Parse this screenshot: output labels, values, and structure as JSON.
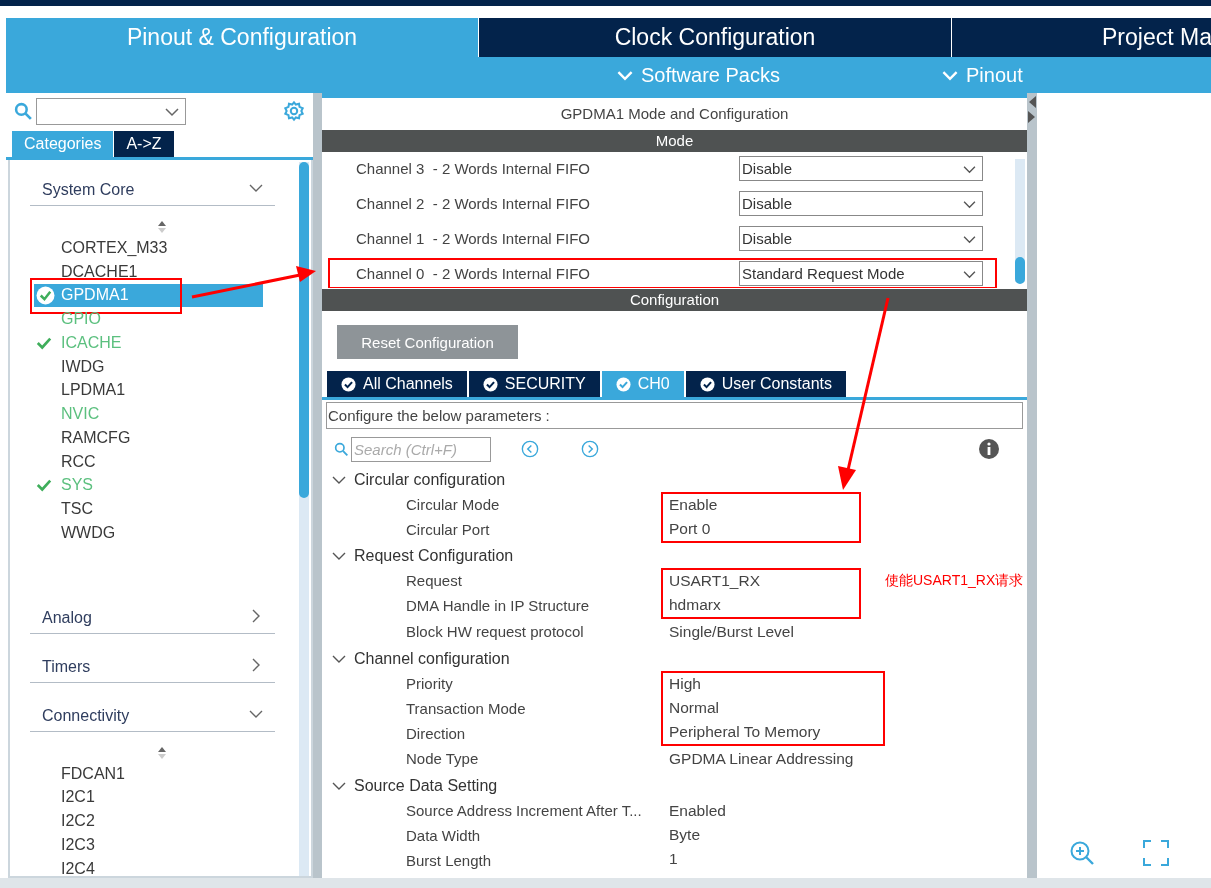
{
  "top_tabs": [
    {
      "label": "Pinout & Configuration",
      "selected": true
    },
    {
      "label": "Clock Configuration",
      "selected": false
    },
    {
      "label": "Project Ma",
      "selected": false
    }
  ],
  "sub_menu": [
    "Software Packs",
    "Pinout"
  ],
  "sidebar": {
    "tabs": [
      {
        "label": "Categories",
        "selected": true
      },
      {
        "label": "A->Z",
        "selected": false
      }
    ],
    "groups": [
      {
        "label": "System Core",
        "expanded": true,
        "items": [
          {
            "label": "CORTEX_M33",
            "checked": false,
            "configured": false,
            "selected": false,
            "highlighted": false
          },
          {
            "label": "DCACHE1",
            "checked": false,
            "configured": false,
            "selected": false,
            "highlighted": false
          },
          {
            "label": "GPDMA1",
            "checked": true,
            "configured": true,
            "selected": true,
            "highlighted": true
          },
          {
            "label": "GPIO",
            "checked": false,
            "configured": true,
            "selected": false,
            "highlighted": false
          },
          {
            "label": "ICACHE",
            "checked": true,
            "configured": true,
            "selected": false,
            "highlighted": false
          },
          {
            "label": "IWDG",
            "checked": false,
            "configured": false,
            "selected": false,
            "highlighted": false
          },
          {
            "label": "LPDMA1",
            "checked": false,
            "configured": false,
            "selected": false,
            "highlighted": false
          },
          {
            "label": "NVIC",
            "checked": false,
            "configured": true,
            "selected": false,
            "highlighted": false
          },
          {
            "label": "RAMCFG",
            "checked": false,
            "configured": false,
            "selected": false,
            "highlighted": false
          },
          {
            "label": "RCC",
            "checked": false,
            "configured": false,
            "selected": false,
            "highlighted": false
          },
          {
            "label": "SYS",
            "checked": true,
            "configured": true,
            "selected": false,
            "highlighted": false
          },
          {
            "label": "TSC",
            "checked": false,
            "configured": false,
            "selected": false,
            "highlighted": false
          },
          {
            "label": "WWDG",
            "checked": false,
            "configured": false,
            "selected": false,
            "highlighted": false
          }
        ]
      },
      {
        "label": "Analog",
        "expanded": false
      },
      {
        "label": "Timers",
        "expanded": false
      },
      {
        "label": "Connectivity",
        "expanded": true,
        "items": [
          {
            "label": "FDCAN1",
            "checked": false,
            "configured": false,
            "selected": false,
            "highlighted": false
          },
          {
            "label": "I2C1",
            "checked": false,
            "configured": false,
            "selected": false,
            "highlighted": false
          },
          {
            "label": "I2C2",
            "checked": false,
            "configured": false,
            "selected": false,
            "highlighted": false
          },
          {
            "label": "I2C3",
            "checked": false,
            "configured": false,
            "selected": false,
            "highlighted": false
          },
          {
            "label": "I2C4",
            "checked": false,
            "configured": false,
            "selected": false,
            "highlighted": false
          }
        ]
      }
    ]
  },
  "panel": {
    "title": "GPDMA1 Mode and Configuration",
    "mode_header": "Mode",
    "mode_rows": [
      {
        "label": "Channel 3  - 2 Words Internal FIFO",
        "value": "Disable",
        "highlighted": false
      },
      {
        "label": "Channel 2  - 2 Words Internal FIFO",
        "value": "Disable",
        "highlighted": false
      },
      {
        "label": "Channel 1  - 2 Words Internal FIFO",
        "value": "Disable",
        "highlighted": false
      },
      {
        "label": "Channel 0  - 2 Words Internal FIFO",
        "value": "Standard Request Mode",
        "highlighted": true
      }
    ],
    "config_header": "Configuration",
    "reset_button": "Reset Configuration",
    "tabs": [
      {
        "label": "All Channels",
        "selected": false
      },
      {
        "label": "SECURITY",
        "selected": false
      },
      {
        "label": "CH0",
        "selected": true
      },
      {
        "label": "User Constants",
        "selected": false
      }
    ],
    "hint": "Configure the below parameters :",
    "search_placeholder": "Search (Ctrl+F)",
    "sections": [
      {
        "label": "Circular configuration",
        "expanded": true,
        "params": [
          {
            "name": "Circular Mode",
            "value": "Enable",
            "highlighted": true
          },
          {
            "name": "Circular Port",
            "value": "Port 0",
            "highlighted": true
          }
        ]
      },
      {
        "label": "Request Configuration",
        "expanded": true,
        "params": [
          {
            "name": "Request",
            "value": "USART1_RX",
            "highlighted": true,
            "note": "使能USART1_RX请求"
          },
          {
            "name": "DMA Handle in IP Structure",
            "value": "hdmarx",
            "highlighted": true
          },
          {
            "name": "Block HW request protocol",
            "value": "Single/Burst Level",
            "highlighted": false
          }
        ]
      },
      {
        "label": "Channel configuration",
        "expanded": true,
        "params": [
          {
            "name": "Priority",
            "value": "High",
            "highlighted": true
          },
          {
            "name": "Transaction Mode",
            "value": "Normal",
            "highlighted": true
          },
          {
            "name": "Direction",
            "value": "Peripheral To Memory",
            "highlighted": true
          },
          {
            "name": "Node Type",
            "value": "GPDMA Linear Addressing",
            "highlighted": false
          }
        ]
      },
      {
        "label": "Source Data Setting",
        "expanded": true,
        "params": [
          {
            "name": "Source Address Increment After T...",
            "value": "Enabled",
            "highlighted": false
          },
          {
            "name": "Data Width",
            "value": "Byte",
            "highlighted": false
          },
          {
            "name": "Burst Length",
            "value": "1",
            "highlighted": false
          }
        ]
      }
    ]
  }
}
